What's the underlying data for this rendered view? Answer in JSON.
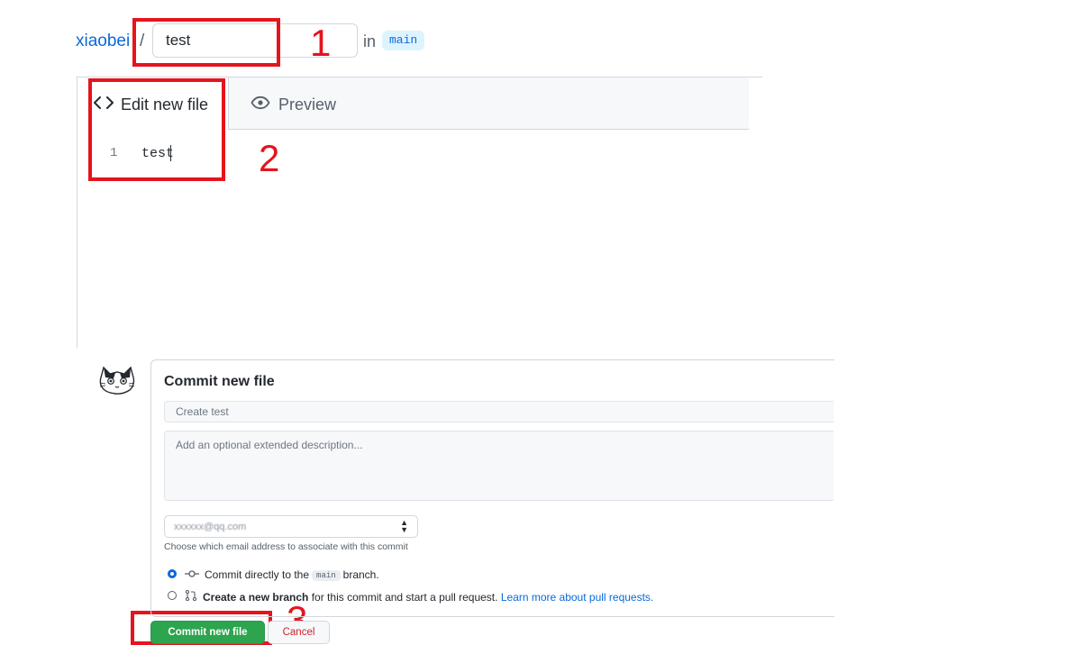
{
  "breadcrumb": {
    "owner": "xiaobei",
    "separator": "/",
    "filename_value": "test",
    "in_label": "in",
    "branch": "main"
  },
  "editor": {
    "tabs": [
      {
        "label": "Edit new file",
        "icon": "code-icon",
        "active": true
      },
      {
        "label": "Preview",
        "icon": "eye-icon",
        "active": false
      }
    ],
    "lines": [
      {
        "number": "1",
        "text": "test"
      }
    ]
  },
  "commit": {
    "title": "Commit new file",
    "summary_placeholder": "Create test",
    "description_placeholder": "Add an optional extended description...",
    "email_value": "xxxxxx@qq.com",
    "email_hint": "Choose which email address to associate with this commit",
    "options": {
      "direct": {
        "prefix": "Commit directly to the",
        "branch": "main",
        "suffix": "branch.",
        "selected": true
      },
      "new_branch": {
        "bold": "Create a new branch",
        "text": "for this commit and start a pull request.",
        "link": "Learn more about pull requests."
      }
    },
    "submit_label": "Commit new file",
    "cancel_label": "Cancel"
  },
  "annotations": [
    {
      "number": "1"
    },
    {
      "number": "2"
    },
    {
      "number": "3"
    }
  ],
  "colors": {
    "annotation_red": "#e5141d",
    "link_blue": "#0969da",
    "commit_green": "#2da44e",
    "cancel_red": "#cf222e"
  }
}
